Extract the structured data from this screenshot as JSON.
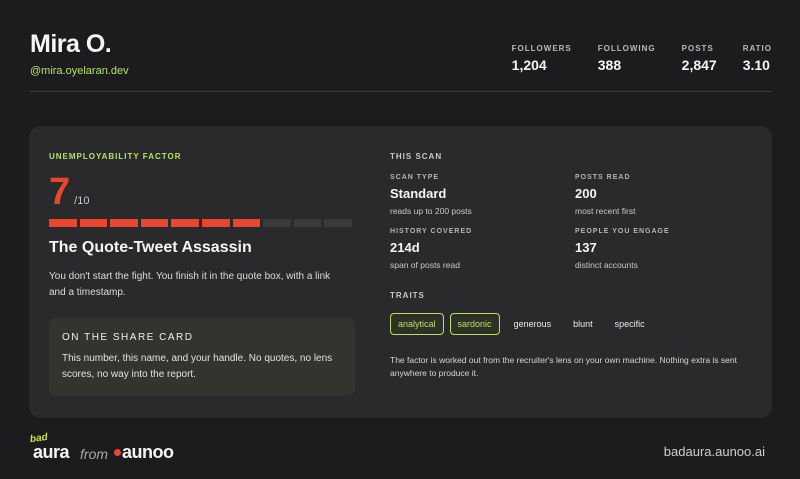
{
  "profile": {
    "name": "Mira O.",
    "handle": "@mira.oyelaran.dev",
    "stats": [
      {
        "label": "FOLLOWERS",
        "value": "1,204"
      },
      {
        "label": "FOLLOWING",
        "value": "388"
      },
      {
        "label": "POSTS",
        "value": "2,847"
      },
      {
        "label": "RATIO",
        "value": "3.10"
      }
    ]
  },
  "factor": {
    "eyebrow": "UNEMPLOYABILITY FACTOR",
    "score": "7",
    "scale": "/10",
    "filled_segments": 7,
    "total_segments": 10,
    "persona": "The Quote-Tweet Assassin",
    "description": "You don't start the fight. You finish it in the quote box, with a link and a timestamp.",
    "share_card": {
      "title": "ON THE SHARE CARD",
      "text": "This number, this name, and your handle. No quotes, no lens scores, no way into the report."
    }
  },
  "scan": {
    "eyebrow": "THIS SCAN",
    "items": [
      {
        "label": "SCAN TYPE",
        "value": "Standard",
        "sub": "reads up to 200 posts"
      },
      {
        "label": "POSTS READ",
        "value": "200",
        "sub": "most recent first"
      },
      {
        "label": "HISTORY COVERED",
        "value": "214d",
        "sub": "span of posts read"
      },
      {
        "label": "PEOPLE YOU ENGAGE",
        "value": "137",
        "sub": "distinct accounts"
      }
    ],
    "traits_label": "TRAITS",
    "traits": [
      {
        "label": "analytical",
        "highlighted": true
      },
      {
        "label": "sardonic",
        "highlighted": true
      },
      {
        "label": "generous",
        "highlighted": false
      },
      {
        "label": "blunt",
        "highlighted": false
      },
      {
        "label": "specific",
        "highlighted": false
      }
    ],
    "footnote": "The factor is worked out from the recruiter's lens on your own machine. Nothing extra is sent anywhere to produce it."
  },
  "brand": {
    "bad": "bad",
    "aura": "aura",
    "from": "from",
    "aunoo": "aunoo",
    "site": "badaura.aunoo.ai"
  },
  "colors": {
    "accent_green": "#b8e065",
    "accent_red": "#e8462f",
    "background": "#1c1c1e",
    "card": "#2a2a2c"
  }
}
